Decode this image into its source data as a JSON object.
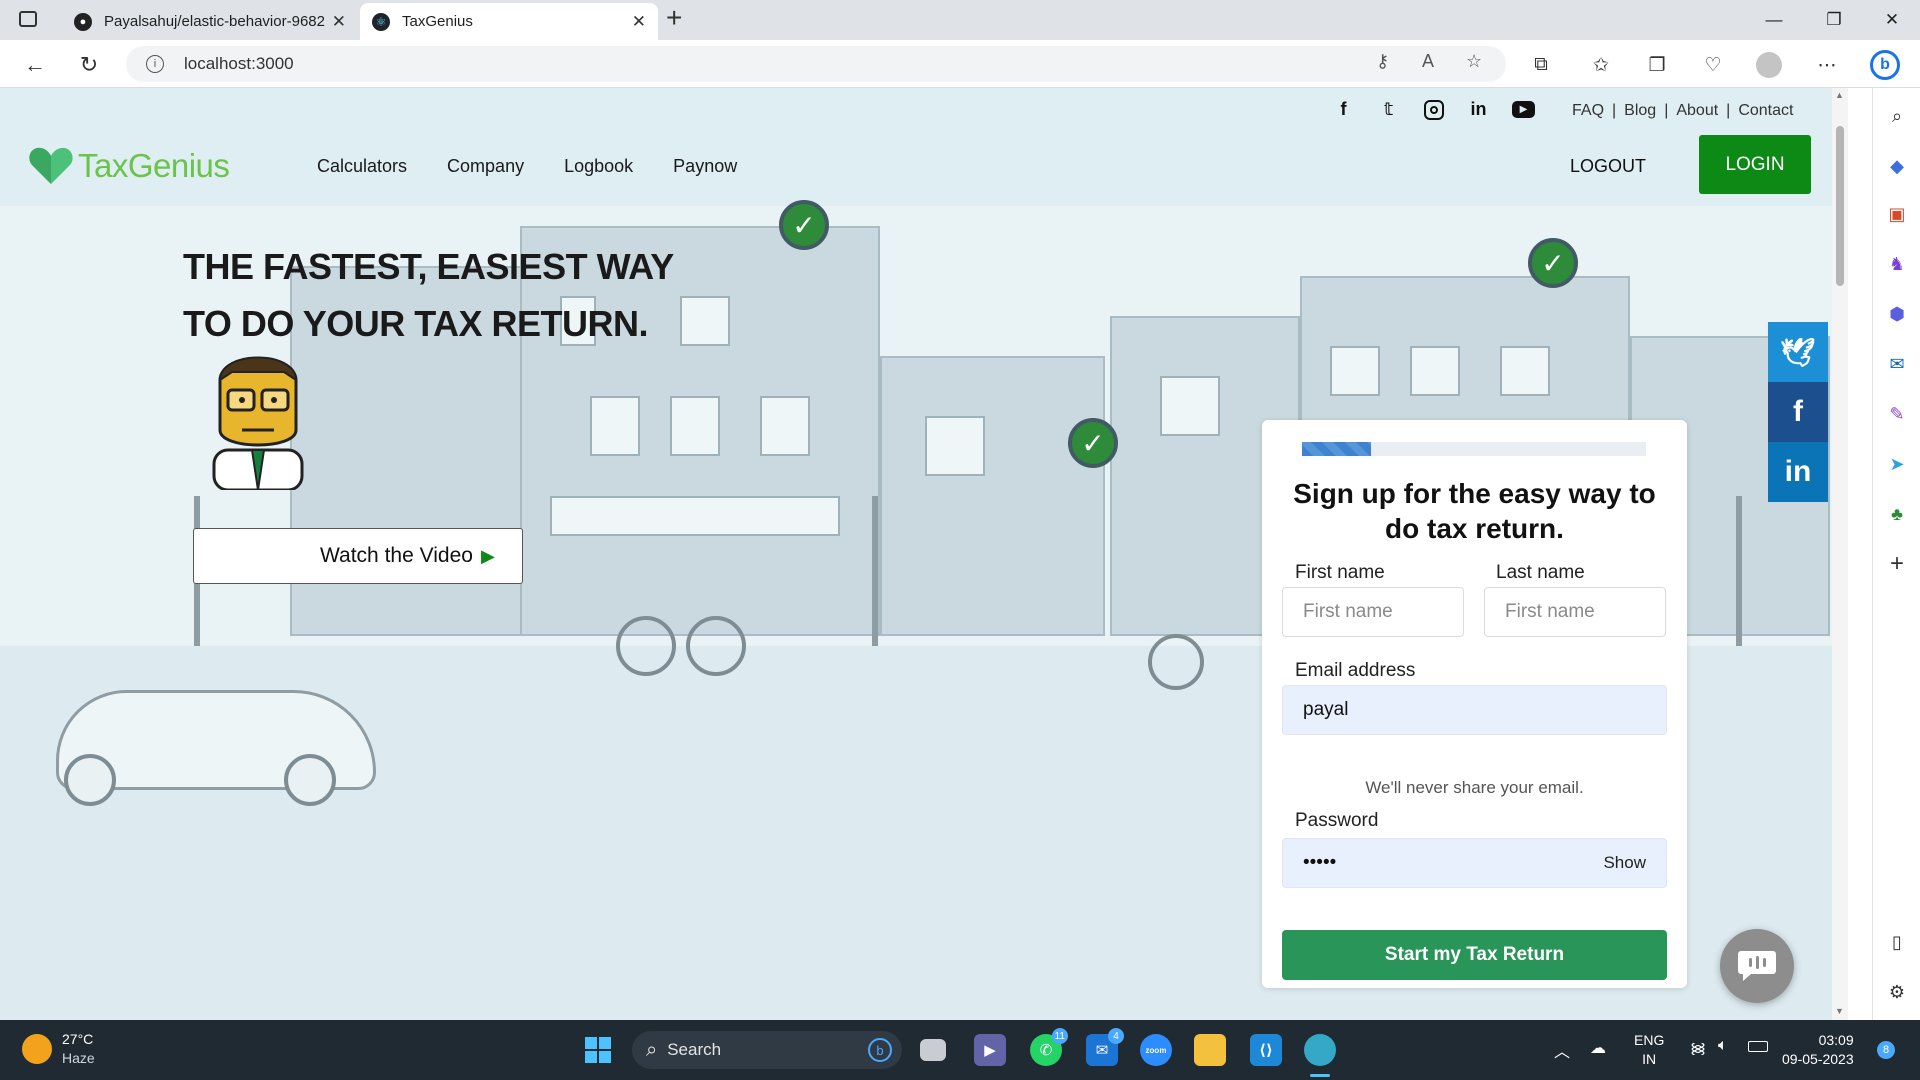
{
  "browser": {
    "tabs": [
      {
        "title": "Payalsahuj/elastic-behavior-9682",
        "active": false
      },
      {
        "title": "TaxGenius",
        "active": true
      }
    ],
    "new_tab": "+",
    "url": "localhost:3000",
    "window_controls": {
      "minimize": "—",
      "maximize": "❐",
      "close": "✕"
    }
  },
  "site": {
    "brand": "TaxGenius",
    "nav": [
      "Calculators",
      "Company",
      "Logbook",
      "Paynow"
    ],
    "social_icons": [
      "facebook-icon",
      "twitter-icon",
      "instagram-icon",
      "linkedin-icon",
      "youtube-icon"
    ],
    "top_links": [
      "FAQ",
      "Blog",
      "About",
      "Contact"
    ],
    "top_link_separator": "|",
    "logout": "LOGOUT",
    "login": "LOGIN",
    "colors": {
      "brand_green": "#6cc34a",
      "login_green": "#0d8a16",
      "cta_green": "#2a9558",
      "progress_blue": "#3d83cd"
    }
  },
  "hero": {
    "headline_line1": "THE FASTEST, EASIEST WAY",
    "headline_line2": "TO DO YOUR TAX RETURN.",
    "watch_video": "Watch the Video"
  },
  "share_bar": [
    "twitter-icon",
    "facebook-icon",
    "linkedin-icon"
  ],
  "signup": {
    "progress": 0.2,
    "title": "Sign up for the easy way to do tax return.",
    "first_name_label": "First name",
    "first_name_placeholder": "First name",
    "last_name_label": "Last name",
    "last_name_placeholder": "First name",
    "email_label": "Email address",
    "email_value": "payal",
    "email_hint": "We'll never share your email.",
    "password_label": "Password",
    "password_value": "•••••",
    "show_label": "Show",
    "submit": "Start my Tax Return"
  },
  "taskbar": {
    "weather_temp": "27°C",
    "weather_desc": "Haze",
    "search": "Search",
    "whatsapp_badge": "11",
    "mail_badge": "4",
    "zoom_label": "zoom",
    "lang_line1": "ENG",
    "lang_line2": "IN",
    "time": "03:09",
    "date": "09-05-2023",
    "notifications": "8"
  }
}
